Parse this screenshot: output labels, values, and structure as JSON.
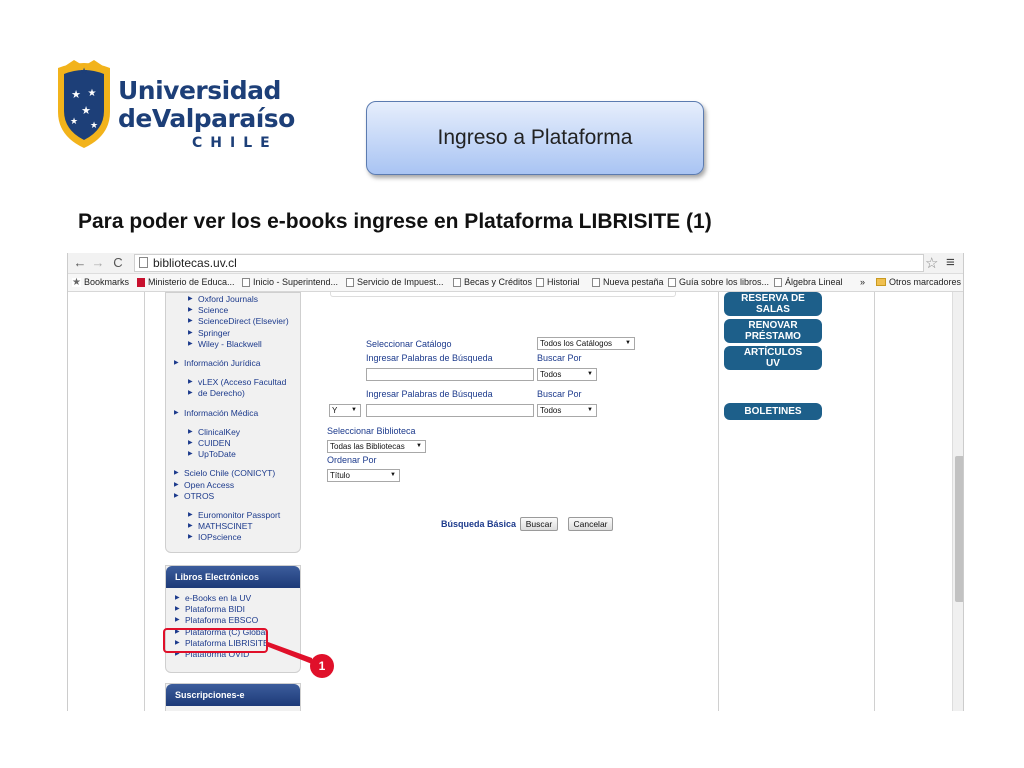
{
  "slide": {
    "logo": {
      "line1": "Universidad",
      "line2": "deValparaíso",
      "line3": "CHILE"
    },
    "title": "Ingreso a Plataforma",
    "subtitle": "Para poder ver los e-books ingrese en Plataforma LIBRISITE (1)",
    "callout": "1",
    "colors": {
      "logo_blue": "#1d3f78",
      "accent_red": "#e0102a",
      "title_box": "#a9c4f3"
    }
  },
  "browser": {
    "url": "bibliotecas.uv.cl",
    "bookmarks": [
      {
        "label": "Bookmarks",
        "icon": "star-icon"
      },
      {
        "label": "Ministerio de Educa...",
        "icon": "flag-icon"
      },
      {
        "label": "Inicio - Superintend...",
        "icon": "page-icon"
      },
      {
        "label": "Servicio de Impuest...",
        "icon": "sii-icon"
      },
      {
        "label": "Becas y Créditos",
        "icon": "page-icon"
      },
      {
        "label": "Historial",
        "icon": "history-icon"
      },
      {
        "label": "Nueva pestaña",
        "icon": "page-icon"
      },
      {
        "label": "Guía sobre los libros...",
        "icon": "page-icon"
      },
      {
        "label": "Álgebra Lineal",
        "icon": "page-icon"
      }
    ],
    "more_bookmarks": "»",
    "other_bookmarks": "Otros marcadores"
  },
  "sidebar": {
    "databases": [
      {
        "label": "Oxford Journals"
      },
      {
        "label": "Science"
      },
      {
        "label": "ScienceDirect (Elsevier)"
      },
      {
        "label": "Springer"
      },
      {
        "label": "Wiley - Blackwell"
      },
      {
        "label": "Información Jurídica"
      },
      {
        "label": "vLEX (Acceso Facultad"
      },
      {
        "label": "de Derecho)"
      },
      {
        "label": "Información Médica"
      },
      {
        "label": "ClinicalKey"
      },
      {
        "label": "CUIDEN"
      },
      {
        "label": "UpToDate"
      },
      {
        "label": "Scielo Chile (CONICYT)"
      },
      {
        "label": "Open Access"
      },
      {
        "label": "OTROS"
      },
      {
        "label": "Euromonitor Passport"
      },
      {
        "label": "MATHSCINET"
      },
      {
        "label": "IOPscience"
      }
    ],
    "ebooks_panel": {
      "title": "Libros Electrónicos",
      "items": [
        {
          "label": "e-Books en la UV"
        },
        {
          "label": "Plataforma BIDI"
        },
        {
          "label": "Plataforma EBSCO"
        },
        {
          "label": "Plataforma (C) Global"
        },
        {
          "label": "Plataforma LIBRISITE"
        },
        {
          "label": "Plataforma OVID"
        }
      ]
    },
    "subscriptions_panel": {
      "title": "Suscripciones-e"
    }
  },
  "search_form": {
    "catalog_label": "Seleccionar Catálogo",
    "catalog_value": "Todos los Catálogos",
    "keywords_label_1": "Ingresar Palabras de Búsqueda",
    "search_by_label_1": "Buscar Por",
    "search_by_value_1": "Todos",
    "keywords_label_2": "Ingresar Palabras de Búsqueda",
    "search_by_label_2": "Buscar Por",
    "search_by_value_2": "Todos",
    "bool_value": "Y",
    "library_label": "Seleccionar Biblioteca",
    "library_value": "Todas las Bibliotecas",
    "order_label": "Ordenar Por",
    "order_value": "Título",
    "basic_search_link": "Búsqueda Básica",
    "search_button": "Buscar",
    "cancel_button": "Cancelar"
  },
  "right_buttons": {
    "reserve_line1": "RESERVA DE",
    "reserve_line2": "SALAS",
    "renew_line1": "RENOVAR",
    "renew_line2": "PRÉSTAMO",
    "articles_line1": "ARTÍCULOS",
    "articles_line2": "UV",
    "newsletters": "BOLETINES"
  }
}
